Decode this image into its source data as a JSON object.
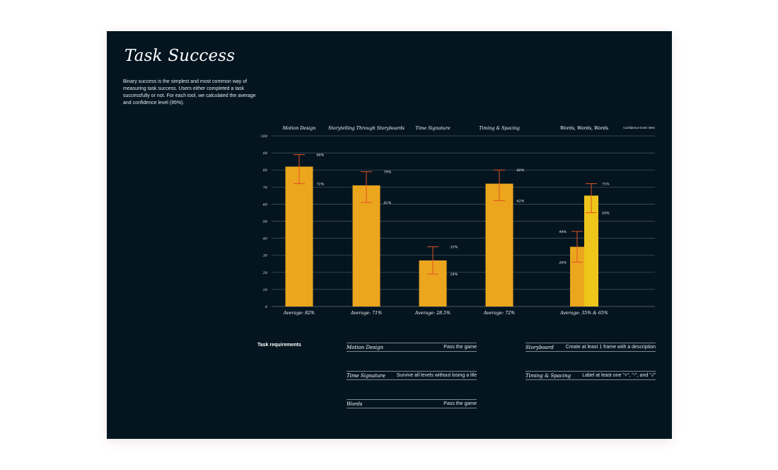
{
  "page": {
    "title": "Task Success",
    "description": "Binary success is the simplest and most common way of measuring task success. Users either completed a task successfully or not. For each tool, we calculated the average and confidence level (95%)."
  },
  "colors": {
    "background": "#041520",
    "bar_primary": "#EBA61E",
    "bar_secondary": "#EEC51A",
    "error_bar": "#E2521E",
    "grid": "#4B5962"
  },
  "chart_data": {
    "type": "bar",
    "confidence_label": "Confidence level: 95%",
    "ylim": [
      0,
      100
    ],
    "yticks": [
      0,
      10,
      20,
      30,
      40,
      50,
      60,
      70,
      80,
      90,
      100
    ],
    "categories": [
      {
        "name": "Motion Design",
        "average_label": "Average: 82%",
        "bars": [
          {
            "value": 82,
            "upper": 89,
            "lower": 72,
            "upper_label": "88%",
            "lower_label": "72%",
            "label_side": "right"
          }
        ]
      },
      {
        "name": "Storytelling Through Storyboards",
        "average_label": "Average: 71%",
        "bars": [
          {
            "value": 71,
            "upper": 79,
            "lower": 61,
            "upper_label": "79%",
            "lower_label": "61%",
            "label_side": "right"
          }
        ]
      },
      {
        "name": "Time Signature",
        "average_label": "Average: 28.5%",
        "bars": [
          {
            "value": 27,
            "upper": 35,
            "lower": 19,
            "upper_label": "33%",
            "lower_label": "18%",
            "label_side": "right"
          }
        ]
      },
      {
        "name": "Timing & Spacing",
        "average_label": "Average: 72%",
        "bars": [
          {
            "value": 72,
            "upper": 80,
            "lower": 62,
            "upper_label": "80%",
            "lower_label": "62%",
            "label_side": "right"
          }
        ]
      },
      {
        "name": "Words, Words, Words",
        "average_label": "Average: 35% & 65%",
        "bars": [
          {
            "value": 35,
            "upper": 44,
            "lower": 26,
            "upper_label": "44%",
            "lower_label": "26%",
            "label_side": "left"
          },
          {
            "value": 65,
            "upper": 72,
            "lower": 55,
            "upper_label": "71%",
            "lower_label": "55%",
            "label_side": "right",
            "secondary": true
          }
        ]
      }
    ]
  },
  "requirements": {
    "heading": "Task requirements",
    "items": [
      {
        "tool": "Motion Design",
        "desc": "Pass the game"
      },
      {
        "tool": "Storyboard",
        "desc": "Create at least 1 frame with a description"
      },
      {
        "tool": "Time Signature",
        "desc": "Survive all levels without losing a life"
      },
      {
        "tool": "Timing & Spacing",
        "desc": "Label at least one \"+\", \"-\", and \"√\""
      },
      {
        "tool": "Words",
        "desc": "Pass the game"
      }
    ]
  }
}
